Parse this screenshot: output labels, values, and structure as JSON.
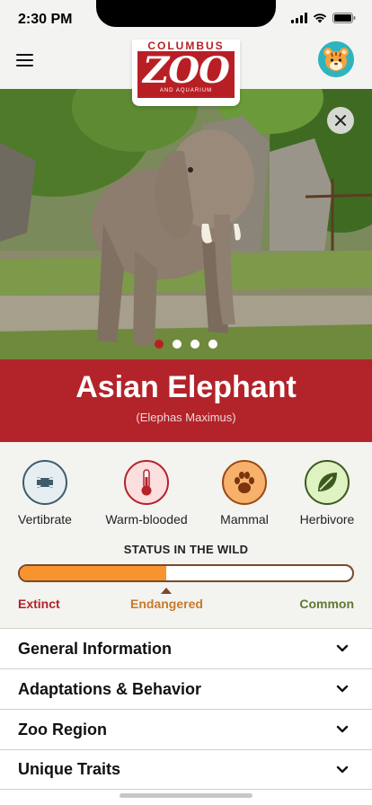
{
  "status_bar": {
    "time": "2:30 PM"
  },
  "header": {
    "menu_icon": "hamburger-menu-icon",
    "logo": {
      "top_text": "COLUMBUS",
      "main_text": "ZOO",
      "sub_text": "AND AQUARIUM"
    },
    "avatar_icon": "tiger-avatar-icon"
  },
  "hero": {
    "image": "asian-elephant-photo",
    "close_icon": "close-icon",
    "slide_count": 4,
    "active_slide": 0
  },
  "animal": {
    "name": "Asian Elephant",
    "scientific_name": "(Elephas Maximus)"
  },
  "traits": [
    {
      "label": "Vertibrate",
      "icon": "bone-icon",
      "color": "#3e5c6b",
      "bg": "#e6eef2"
    },
    {
      "label": "Warm-blooded",
      "icon": "thermometer-icon",
      "color": "#b3232a",
      "bg": "#fbdede"
    },
    {
      "label": "Mammal",
      "icon": "paw-icon",
      "color": "#9a4a14",
      "bg": "#f7b16b"
    },
    {
      "label": "Herbivore",
      "icon": "leaf-icon",
      "color": "#3d5a1e",
      "bg": "#dff2c2"
    }
  ],
  "status_in_wild": {
    "heading": "STATUS IN THE WILD",
    "level_percent": 44,
    "current": "Endangered",
    "low_label": "Extinct",
    "high_label": "Common",
    "colors": {
      "fill": "#f7942e",
      "border": "#7a4a2a",
      "extinct": "#b3232a",
      "endangered": "#c77a2b",
      "common": "#5d7a2f"
    }
  },
  "sections": [
    {
      "label": "General Information",
      "icon": "chevron-down-icon"
    },
    {
      "label": "Adaptations & Behavior",
      "icon": "chevron-down-icon"
    },
    {
      "label": "Zoo Region",
      "icon": "chevron-down-icon"
    },
    {
      "label": "Unique Traits",
      "icon": "chevron-down-icon"
    }
  ],
  "colors": {
    "brand_red": "#b3232a",
    "background": "#f3f3ef"
  }
}
